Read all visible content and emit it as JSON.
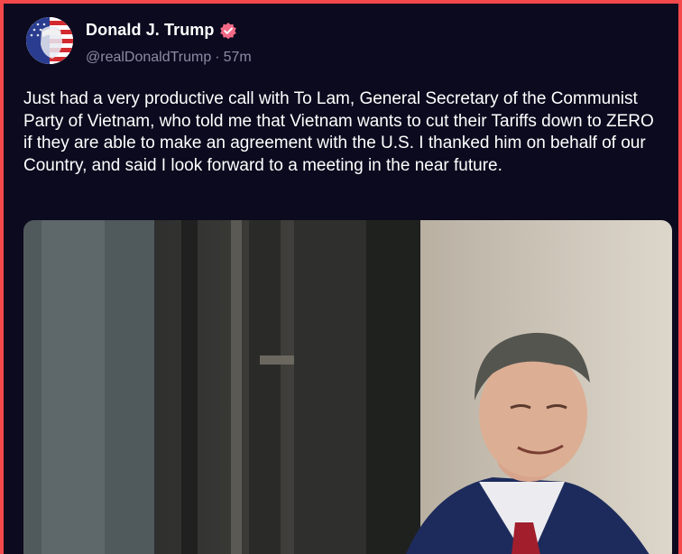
{
  "post": {
    "author_name": "Donald J. Trump",
    "handle": "@realDonaldTrump",
    "separator": "·",
    "time_ago": "57m",
    "body": "Just had a very productive call with To Lam, General Secretary of the Communist Party of Vietnam, who told me that Vietnam wants to cut their Tariffs down to ZERO if they are able to make an agreement with the U.S. I thanked him on behalf of our Country, and said I look forward to a meeting in the near future."
  },
  "icons": {
    "verified": "verified-badge-icon",
    "avatar": "avatar"
  },
  "colors": {
    "background": "#0c0a1e",
    "border": "#f5484a",
    "verified_badge": "#f46a86",
    "muted_text": "#8d8aa5"
  }
}
